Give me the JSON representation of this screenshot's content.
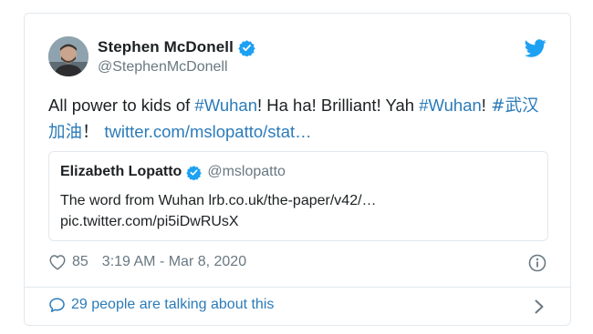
{
  "author": {
    "display_name": "Stephen McDonell",
    "handle": "@StephenMcDonell",
    "avatar_icon": "avatar-photo",
    "verified": true
  },
  "tweet": {
    "text_1": "All power to kids of ",
    "hashtag_1": "#Wuhan",
    "text_2": "! Ha ha! Brilliant! Yah ",
    "hashtag_2": "#Wuhan",
    "text_3": "! ",
    "hashtag_3": "#武汉加油",
    "text_4": "！ ",
    "link": "twitter.com/mslopatto/stat…"
  },
  "quoted_tweet": {
    "display_name": "Elizabeth Lopatto",
    "handle": "@mslopatto",
    "verified": true,
    "text_line_1": "The word from Wuhan  lrb.co.uk/the-paper/v42/…",
    "text_line_2": "pic.twitter.com/pi5iDwRUsX"
  },
  "meta": {
    "like_count": "85",
    "timestamp": "3:19 AM - Mar 8, 2020"
  },
  "conversation": {
    "label": "29 people are talking about this"
  },
  "icons": {
    "brand": "twitter-bird-icon",
    "verified": "verified-badge-icon",
    "like": "heart-icon",
    "info": "info-icon",
    "conversation": "comment-icon",
    "more": "chevron-right-icon"
  },
  "colors": {
    "link": "#2b7bb9",
    "brand_blue": "#1da1f2",
    "text": "#1c2022",
    "secondary_text": "#697882",
    "border": "#e1e8ed"
  }
}
